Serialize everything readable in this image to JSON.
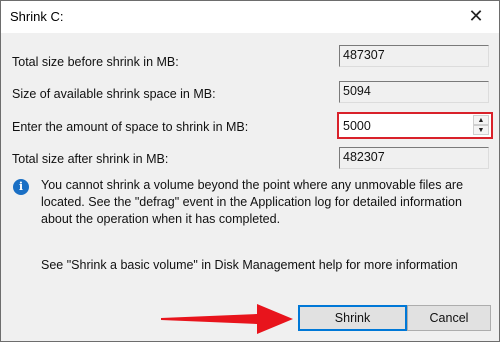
{
  "window": {
    "title": "Shrink C:",
    "close_glyph": "✕"
  },
  "fields": {
    "total_before_label": "Total size before shrink in MB:",
    "total_before_value": "487307",
    "available_label": "Size of available shrink space in MB:",
    "available_value": "5094",
    "enter_label": "Enter the amount of space to shrink in MB:",
    "enter_value": "5000",
    "total_after_label": "Total size after shrink in MB:",
    "total_after_value": "482307"
  },
  "info": {
    "icon": "info-icon",
    "text": "You cannot shrink a volume beyond the point where any unmovable files are located. See the \"defrag\" event in the Application log for detailed information about the operation when it has completed.",
    "help": "See \"Shrink a basic volume\" in Disk Management help for more information"
  },
  "buttons": {
    "shrink": "Shrink",
    "cancel": "Cancel"
  },
  "colors": {
    "highlight_border": "#d9212a",
    "arrow": "#e8141c",
    "default_button_border": "#0078d7",
    "info_icon": "#1a6fc4"
  }
}
